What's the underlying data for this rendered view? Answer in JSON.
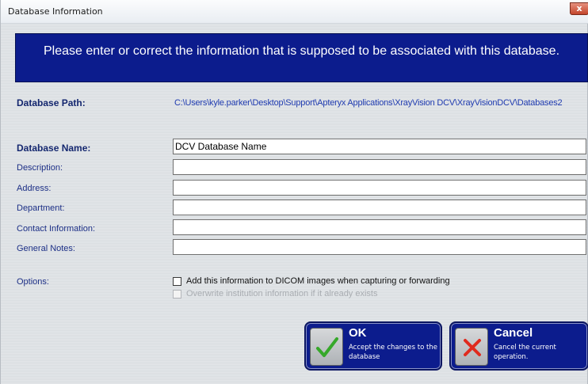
{
  "window": {
    "title": "Database Information",
    "close_label": "x"
  },
  "banner": {
    "text": "Please enter or correct the information that is supposed to be associated with this database."
  },
  "form": {
    "path_label": "Database Path:",
    "path_value": "C:\\Users\\kyle.parker\\Desktop\\Support\\Apteryx Applications\\XrayVision DCV\\XrayVisionDCV\\Databases2",
    "name_label": "Database Name:",
    "name_value": "DCV Database Name",
    "description_label": "Description:",
    "description_value": "",
    "address_label": "Address:",
    "address_value": "",
    "department_label": "Department:",
    "department_value": "",
    "contact_label": "Contact Information:",
    "contact_value": "",
    "notes_label": "General Notes:",
    "notes_value": "",
    "options_label": "Options:",
    "option_dicom": "Add this information to DICOM images when capturing or forwarding",
    "option_overwrite": "Overwrite institution information if it already exists"
  },
  "buttons": {
    "ok_title": "OK",
    "ok_desc": "Accept the changes to the database",
    "cancel_title": "Cancel",
    "cancel_desc": "Cancel the current operation."
  },
  "icons": {
    "ok": "checkmark-icon",
    "cancel": "x-mark-icon",
    "close": "close-icon"
  },
  "colors": {
    "banner_bg": "#0c1c8d",
    "label_text": "#1c2f86",
    "path_text": "#1f3bb0",
    "ok_check": "#36a82a",
    "cancel_x": "#e02a1e"
  }
}
